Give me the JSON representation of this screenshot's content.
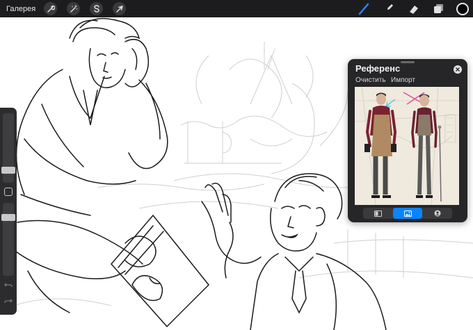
{
  "toolbar": {
    "gallery_label": "Галерея",
    "left_tools": [
      {
        "name": "wrench-icon"
      },
      {
        "name": "magic-wand-icon"
      },
      {
        "name": "selection-s-icon"
      },
      {
        "name": "transform-arrow-icon"
      }
    ],
    "right_tools": [
      {
        "name": "brush-icon",
        "active": true
      },
      {
        "name": "smudge-icon"
      },
      {
        "name": "eraser-icon"
      },
      {
        "name": "layers-icon"
      }
    ],
    "current_color": "#000000",
    "accent_color": "#2f7bf5"
  },
  "sidebar": {
    "brush_size_level": 0.55,
    "opacity_level": 0.45
  },
  "reference": {
    "title": "Референс",
    "clear_label": "Очистить",
    "import_label": "Импорт",
    "tabs": [
      {
        "name": "canvas-tab",
        "icon": "canvas-icon"
      },
      {
        "name": "image-tab",
        "icon": "image-icon",
        "active": true
      },
      {
        "name": "face-tab",
        "icon": "face-icon"
      }
    ]
  }
}
